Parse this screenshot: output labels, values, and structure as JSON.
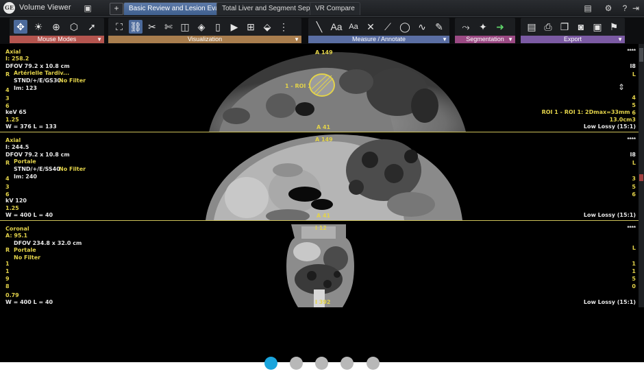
{
  "app": {
    "title": "Volume Viewer",
    "logo": "GE"
  },
  "tabs": [
    {
      "label": "Basic Review and Lesion Evaluation",
      "active": true
    },
    {
      "label": "Total Liver and Segment Separation",
      "active": false
    },
    {
      "label": "VR Compare",
      "active": false
    }
  ],
  "toolbar": {
    "groups": [
      {
        "label": "Mouse Modes",
        "icons": [
          "move-icon",
          "brightness-icon",
          "zoom-icon",
          "rotate-3d-icon",
          "pointer-icon"
        ]
      },
      {
        "label": "Visualization",
        "icons": [
          "fit-view-icon",
          "link-icon",
          "cut-plane-icon",
          "cut-oblique-icon",
          "cube-icon",
          "volume-icon",
          "book-icon",
          "film-icon",
          "layout-icon",
          "paint-bucket-icon",
          "landmark-icon"
        ]
      },
      {
        "label": "Measure / Annotate",
        "icons": [
          "ruler-icon",
          "text-annotation-icon",
          "text-edit-icon",
          "cross-icon",
          "line-icon",
          "ellipse-roi-icon",
          "curve-icon",
          "freehand-roi-icon"
        ]
      },
      {
        "label": "Segmentation",
        "icons": [
          "lasso-icon",
          "wand-icon",
          "segment-export-icon"
        ]
      },
      {
        "label": "Export",
        "icons": [
          "report-icon",
          "print-icon",
          "copy-icon",
          "camera-icon",
          "save-icon",
          "run-icon"
        ]
      }
    ],
    "right_icons": [
      "monitor-icon",
      "settings-icon",
      "help-icon",
      "exit-icon"
    ]
  },
  "viewports": [
    {
      "orientation": "Axial",
      "top_marker": "A 149",
      "bottom_marker": "A 41",
      "stars": "****",
      "left_lines": [
        "Axial",
        "I: 258.2",
        "DFOV 79.2 x 10.8 cm",
        "R",
        "4",
        "3",
        "6",
        "keV 65",
        "1.25"
      ],
      "series_lines": [
        "Artérielle Tardiv...",
        "STND/+/E/GS30",
        "Im: 123"
      ],
      "filter": "No Filter",
      "window": "W = 376 L = 133",
      "right_lines": [
        "I8",
        "L",
        "4",
        "5",
        "6"
      ],
      "roi_label": "1 - ROI 1",
      "measurement": "ROI 1 - ROI 1: 2Dmax=33mm",
      "volume": "13.0cm3",
      "compression": "Low Lossy (15:1)"
    },
    {
      "orientation": "Axial",
      "top_marker": "A 149",
      "bottom_marker": "A 41",
      "stars": "****",
      "left_lines": [
        "Axial",
        "I: 244.5",
        "DFOV 79.2 x 10.8 cm",
        "R",
        "4",
        "3",
        "6",
        "kV 120",
        "1.25"
      ],
      "series_lines": [
        "Portale",
        "STND/+/E/SS40",
        "Im: 240"
      ],
      "filter": "No Filter",
      "window": "W = 400 L = 40",
      "right_lines": [
        "I8",
        "L",
        "3",
        "5",
        "6"
      ],
      "compression": "Low Lossy (15:1)"
    },
    {
      "orientation": "Coronal",
      "top_marker": "I 12",
      "bottom_marker": "I 392",
      "stars": "****",
      "left_lines": [
        "Coronal",
        "A: 95.1",
        "DFOV 234.8 x 32.0 cm",
        "R",
        "1",
        "1",
        "9",
        "8",
        "0.79"
      ],
      "series_lines": [
        "Portale",
        "No Filter"
      ],
      "window": "W = 400 L = 40",
      "right_lines": [
        "L",
        "1",
        "1",
        "5",
        "0"
      ],
      "compression": "Low Lossy (15:1)"
    }
  ],
  "pagination": {
    "count": 5,
    "active_index": 0
  },
  "colors": {
    "overlay_yellow": "#e3d34a",
    "tab_active": "#4f6e9e",
    "mouse_modes": "#b5554f",
    "visualization": "#a97e4e",
    "measure": "#5a6ea3",
    "segmentation": "#9b4a84",
    "export": "#7b5aa3",
    "page_dot_active": "#1aa5dd"
  }
}
